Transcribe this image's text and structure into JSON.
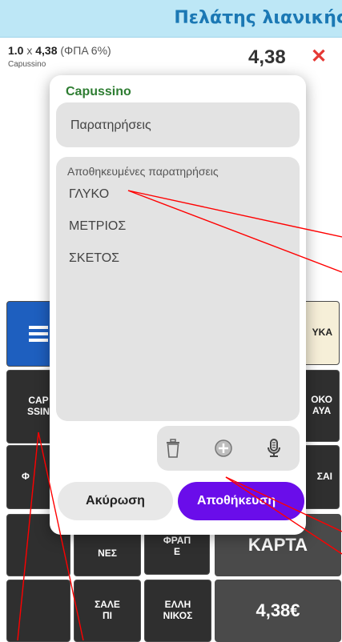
{
  "header": {
    "customer_label": "Πελάτης λιανικής"
  },
  "line_item": {
    "qty": "1.0",
    "times": "x",
    "price": "4,38",
    "vat": "(ΦΠΑ 6%)",
    "name": "Capussino",
    "total": "4,38",
    "delete_glyph": "✕"
  },
  "grid": {
    "tiles": [
      {
        "label": "ΥΚΑ"
      },
      {
        "label": "CAP\nSSIN"
      },
      {
        "label": "ΟΚΟ\nΑΥΑ"
      },
      {
        "label": "Φ"
      },
      {
        "label": "ΣΑΙ"
      },
      {
        "label": "ΝΕΣ"
      },
      {
        "label": "ΦΡΑΠ\nΕ"
      },
      {
        "label": "ΚΑΡΤΑ"
      },
      {
        "label": "ΣΑΛΕ\nΠΙ"
      },
      {
        "label": "ΕΛΛΗ\nΝΙΚΟΣ"
      },
      {
        "label": "4,38€"
      }
    ]
  },
  "dialog": {
    "title": "Capussino",
    "notes_placeholder": "Παρατηρήσεις",
    "saved_label": "Αποθηκευμένες παρατηρήσεις",
    "saved_items": [
      "ΓΛΥΚΟ",
      "ΜΕΤΡΙΟΣ",
      "ΣΚΕΤΟΣ"
    ],
    "cancel_label": "Ακύρωση",
    "save_label": "Αποθήκευση"
  },
  "icons": [
    "menu-icon",
    "trash-icon",
    "add-circle-icon",
    "microphone-icon"
  ],
  "colors": {
    "header_bg": "#bde7f6",
    "accent_purple": "#6a0dea",
    "title_green": "#2e7d32",
    "delete_red": "#e53935",
    "annotation_red": "#ff0000"
  }
}
